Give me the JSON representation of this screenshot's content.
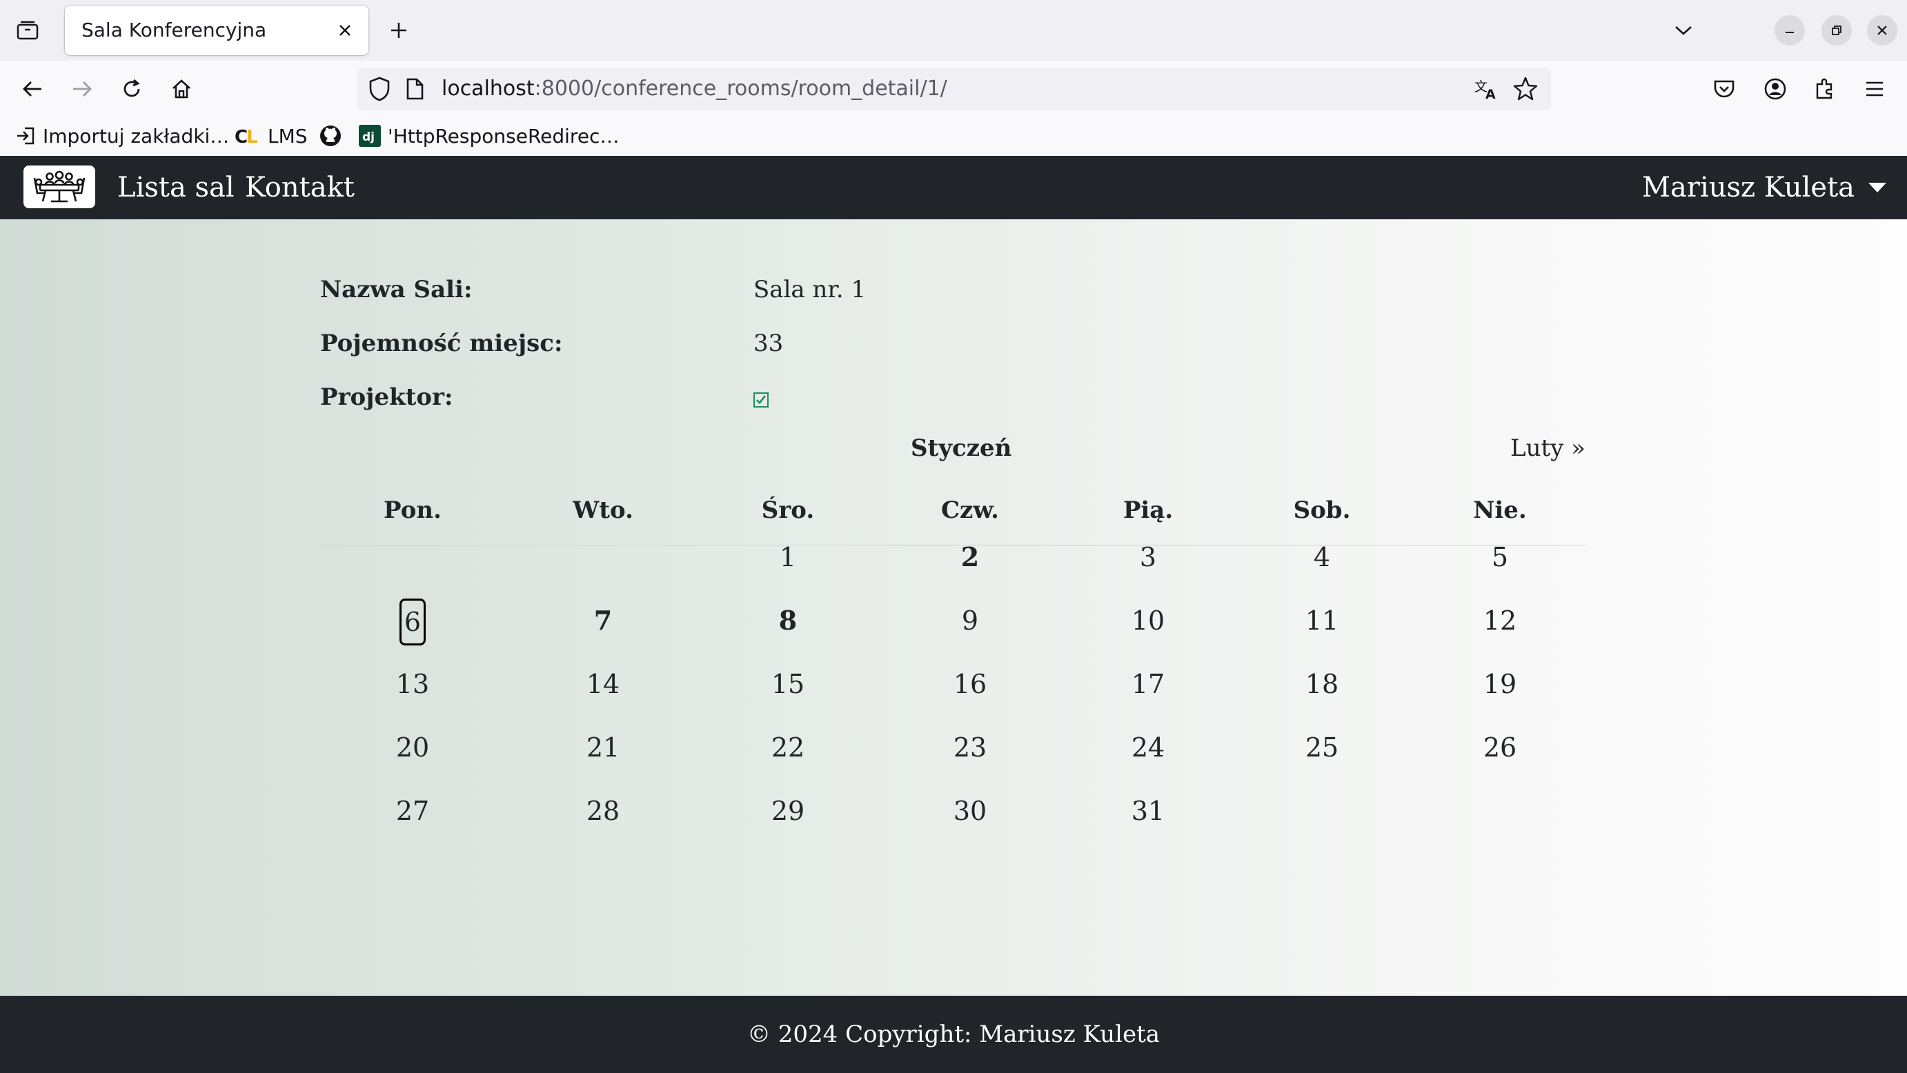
{
  "browser": {
    "tab_title": "Sala Konferencyjna",
    "url_host": "localhost",
    "url_rest": ":8000/conference_rooms/room_detail/1/",
    "bookmarks": [
      "Importuj zakładki…",
      "LMS",
      "'HttpResponseRedirec…"
    ]
  },
  "site": {
    "nav_links": [
      "Lista sal",
      "Kontakt"
    ],
    "user_name": "Mariusz Kuleta"
  },
  "room": {
    "name_label": "Nazwa Sali:",
    "name_value": "Sala nr. 1",
    "capacity_label": "Pojemność miejsc:",
    "capacity_value": "33",
    "projector_label": "Projektor:",
    "projector_value": true
  },
  "calendar": {
    "month": "Styczeń",
    "next_link": "Luty »",
    "weekdays": [
      "Pon.",
      "Wto.",
      "Śro.",
      "Czw.",
      "Pią.",
      "Sob.",
      "Nie."
    ],
    "first_weekday_index": 2,
    "days_in_month": 31,
    "today": 6,
    "bold_days": [
      2,
      7,
      8
    ]
  },
  "footer": {
    "text": "© 2024 Copyright: Mariusz Kuleta"
  },
  "colors": {
    "dark_bar": "#212529",
    "check_green": "#1a8f5a"
  }
}
